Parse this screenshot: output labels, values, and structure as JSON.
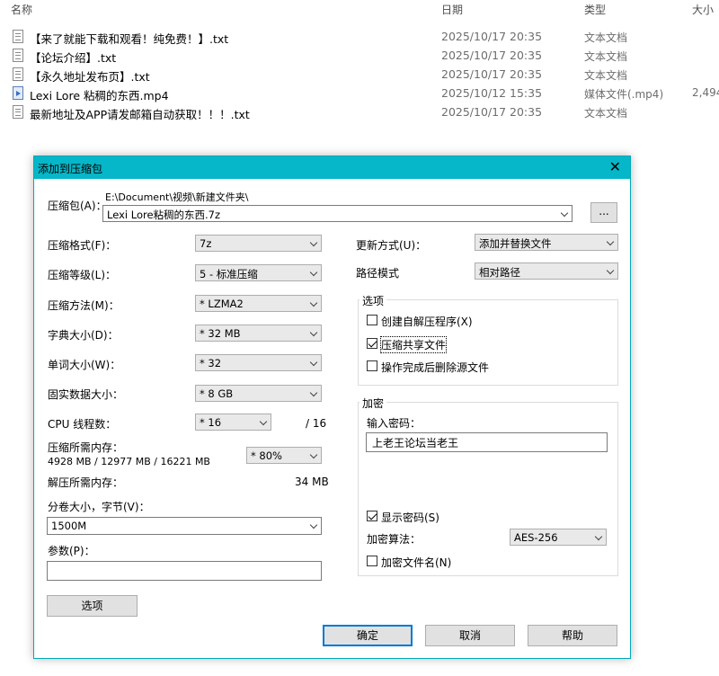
{
  "explorer": {
    "columns": {
      "name": "名称",
      "date": "日期",
      "type": "类型",
      "size": "大小"
    },
    "files": [
      {
        "name": "【来了就能下载和观看！纯免费！】.txt",
        "date": "2025/10/17 20:35",
        "type": "文本文档",
        "size": "",
        "icon": "txt-file-icon"
      },
      {
        "name": "【论坛介绍】.txt",
        "date": "2025/10/17 20:35",
        "type": "文本文档",
        "size": "",
        "icon": "txt-file-icon"
      },
      {
        "name": "【永久地址发布页】.txt",
        "date": "2025/10/17 20:35",
        "type": "文本文档",
        "size": "",
        "icon": "txt-file-icon"
      },
      {
        "name": "Lexi Lore 粘稠的东西.mp4",
        "date": "2025/10/12 15:35",
        "type": "媒体文件(.mp4)",
        "size": "2,494",
        "icon": "video-file-icon"
      },
      {
        "name": "最新地址及APP请发邮箱自动获取！！！.txt",
        "date": "2025/10/17 20:35",
        "type": "文本文档",
        "size": "",
        "icon": "txt-file-icon"
      }
    ]
  },
  "dialog": {
    "title": "添加到压缩包",
    "archive": {
      "label": "压缩包(A)：",
      "path": "E:\\Document\\视频\\新建文件夹\\",
      "filename": "Lexi Lore粘稠的东西.7z",
      "browse_label": "..."
    },
    "left": {
      "format": {
        "label": "压缩格式(F)：",
        "value": "7z"
      },
      "level": {
        "label": "压缩等级(L)：",
        "value": "5 - 标准压缩"
      },
      "method": {
        "label": "压缩方法(M)：",
        "value": "* LZMA2"
      },
      "dict": {
        "label": "字典大小(D)：",
        "value": "* 32 MB"
      },
      "word": {
        "label": "单词大小(W)：",
        "value": "* 32"
      },
      "solid": {
        "label": "固实数据大小：",
        "value": "* 8 GB"
      },
      "threads": {
        "label": "CPU 线程数：",
        "value": "* 16",
        "total": "/ 16"
      },
      "mem_comp": {
        "label": "压缩所需内存：",
        "detail": "4928 MB / 12977 MB / 16221 MB",
        "value": "* 80%"
      },
      "mem_decomp": {
        "label": "解压所需内存：",
        "value": "34 MB"
      },
      "volume": {
        "label": "分卷大小，字节(V)：",
        "value": "1500M"
      },
      "params": {
        "label": "参数(P)：",
        "value": ""
      },
      "options_button": "选项"
    },
    "right": {
      "update": {
        "label": "更新方式(U)：",
        "value": "添加并替换文件"
      },
      "path_mode": {
        "label": "路径模式",
        "value": "相对路径"
      },
      "options_group": {
        "title": "选项",
        "sfx": {
          "label": "创建自解压程序(X)",
          "checked": false
        },
        "shared": {
          "label": "压缩共享文件",
          "checked": true
        },
        "delete_src": {
          "label": "操作完成后删除源文件",
          "checked": false
        }
      },
      "encrypt_group": {
        "title": "加密",
        "pwd_label": "输入密码：",
        "pwd_value": "上老王论坛当老王",
        "show_pwd": {
          "label": "显示密码(S)",
          "checked": true
        },
        "algo_label": "加密算法：",
        "algo_value": "AES-256",
        "enc_names": {
          "label": "加密文件名(N)",
          "checked": false
        }
      }
    },
    "buttons": {
      "ok": "确定",
      "cancel": "取消",
      "help": "帮助"
    }
  }
}
